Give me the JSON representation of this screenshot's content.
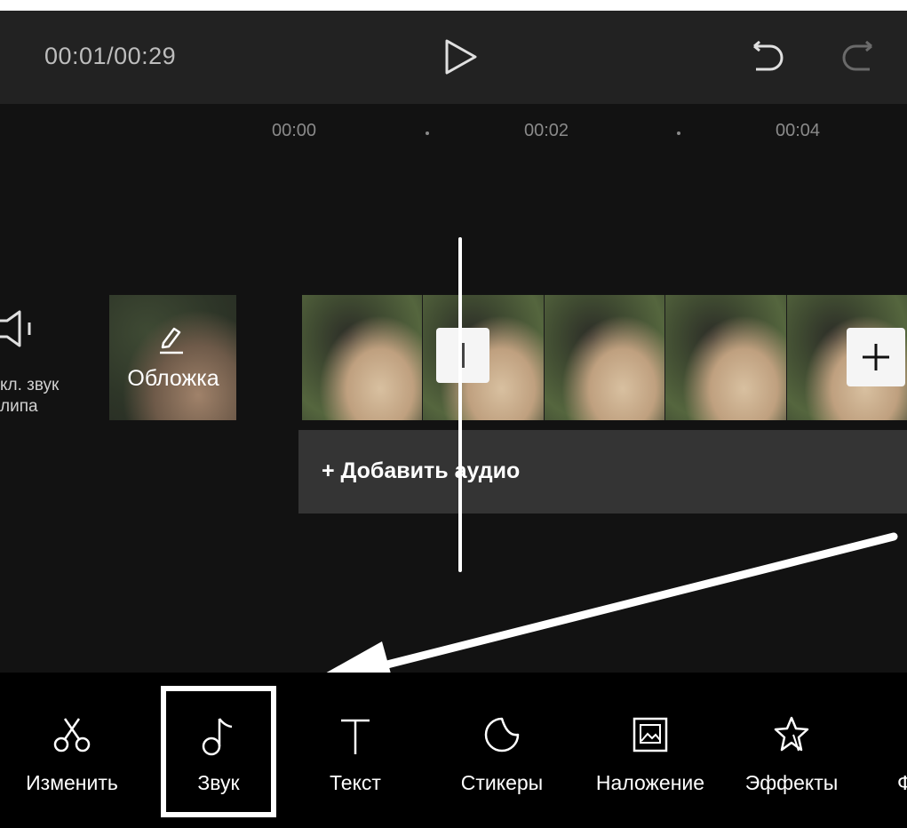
{
  "header": {
    "time": "00:01/00:29",
    "play_icon": "play-icon",
    "undo_icon": "undo-icon",
    "redo_icon": "redo-icon"
  },
  "ruler": {
    "marks": [
      "00:00",
      "00:02",
      "00:04"
    ]
  },
  "timeline": {
    "mute_label_line1": "кл. звук",
    "mute_label_line2": "липа",
    "cover_label": "Обложка",
    "add_audio_label": "+ Добавить аудио"
  },
  "toolbar": {
    "items": [
      {
        "label": "Изменить",
        "icon": "scissors-icon"
      },
      {
        "label": "Звук",
        "icon": "music-note-icon"
      },
      {
        "label": "Текст",
        "icon": "text-icon"
      },
      {
        "label": "Стикеры",
        "icon": "sticker-icon"
      },
      {
        "label": "Наложение",
        "icon": "overlay-icon"
      },
      {
        "label": "Эффекты",
        "icon": "effects-star-icon"
      },
      {
        "label": "Ф",
        "icon": ""
      }
    ]
  },
  "colors": {
    "background": "#121212",
    "topbar": "#222222",
    "audio_track": "#343434",
    "toolbar": "#000000",
    "annotation": "#ffffff"
  }
}
